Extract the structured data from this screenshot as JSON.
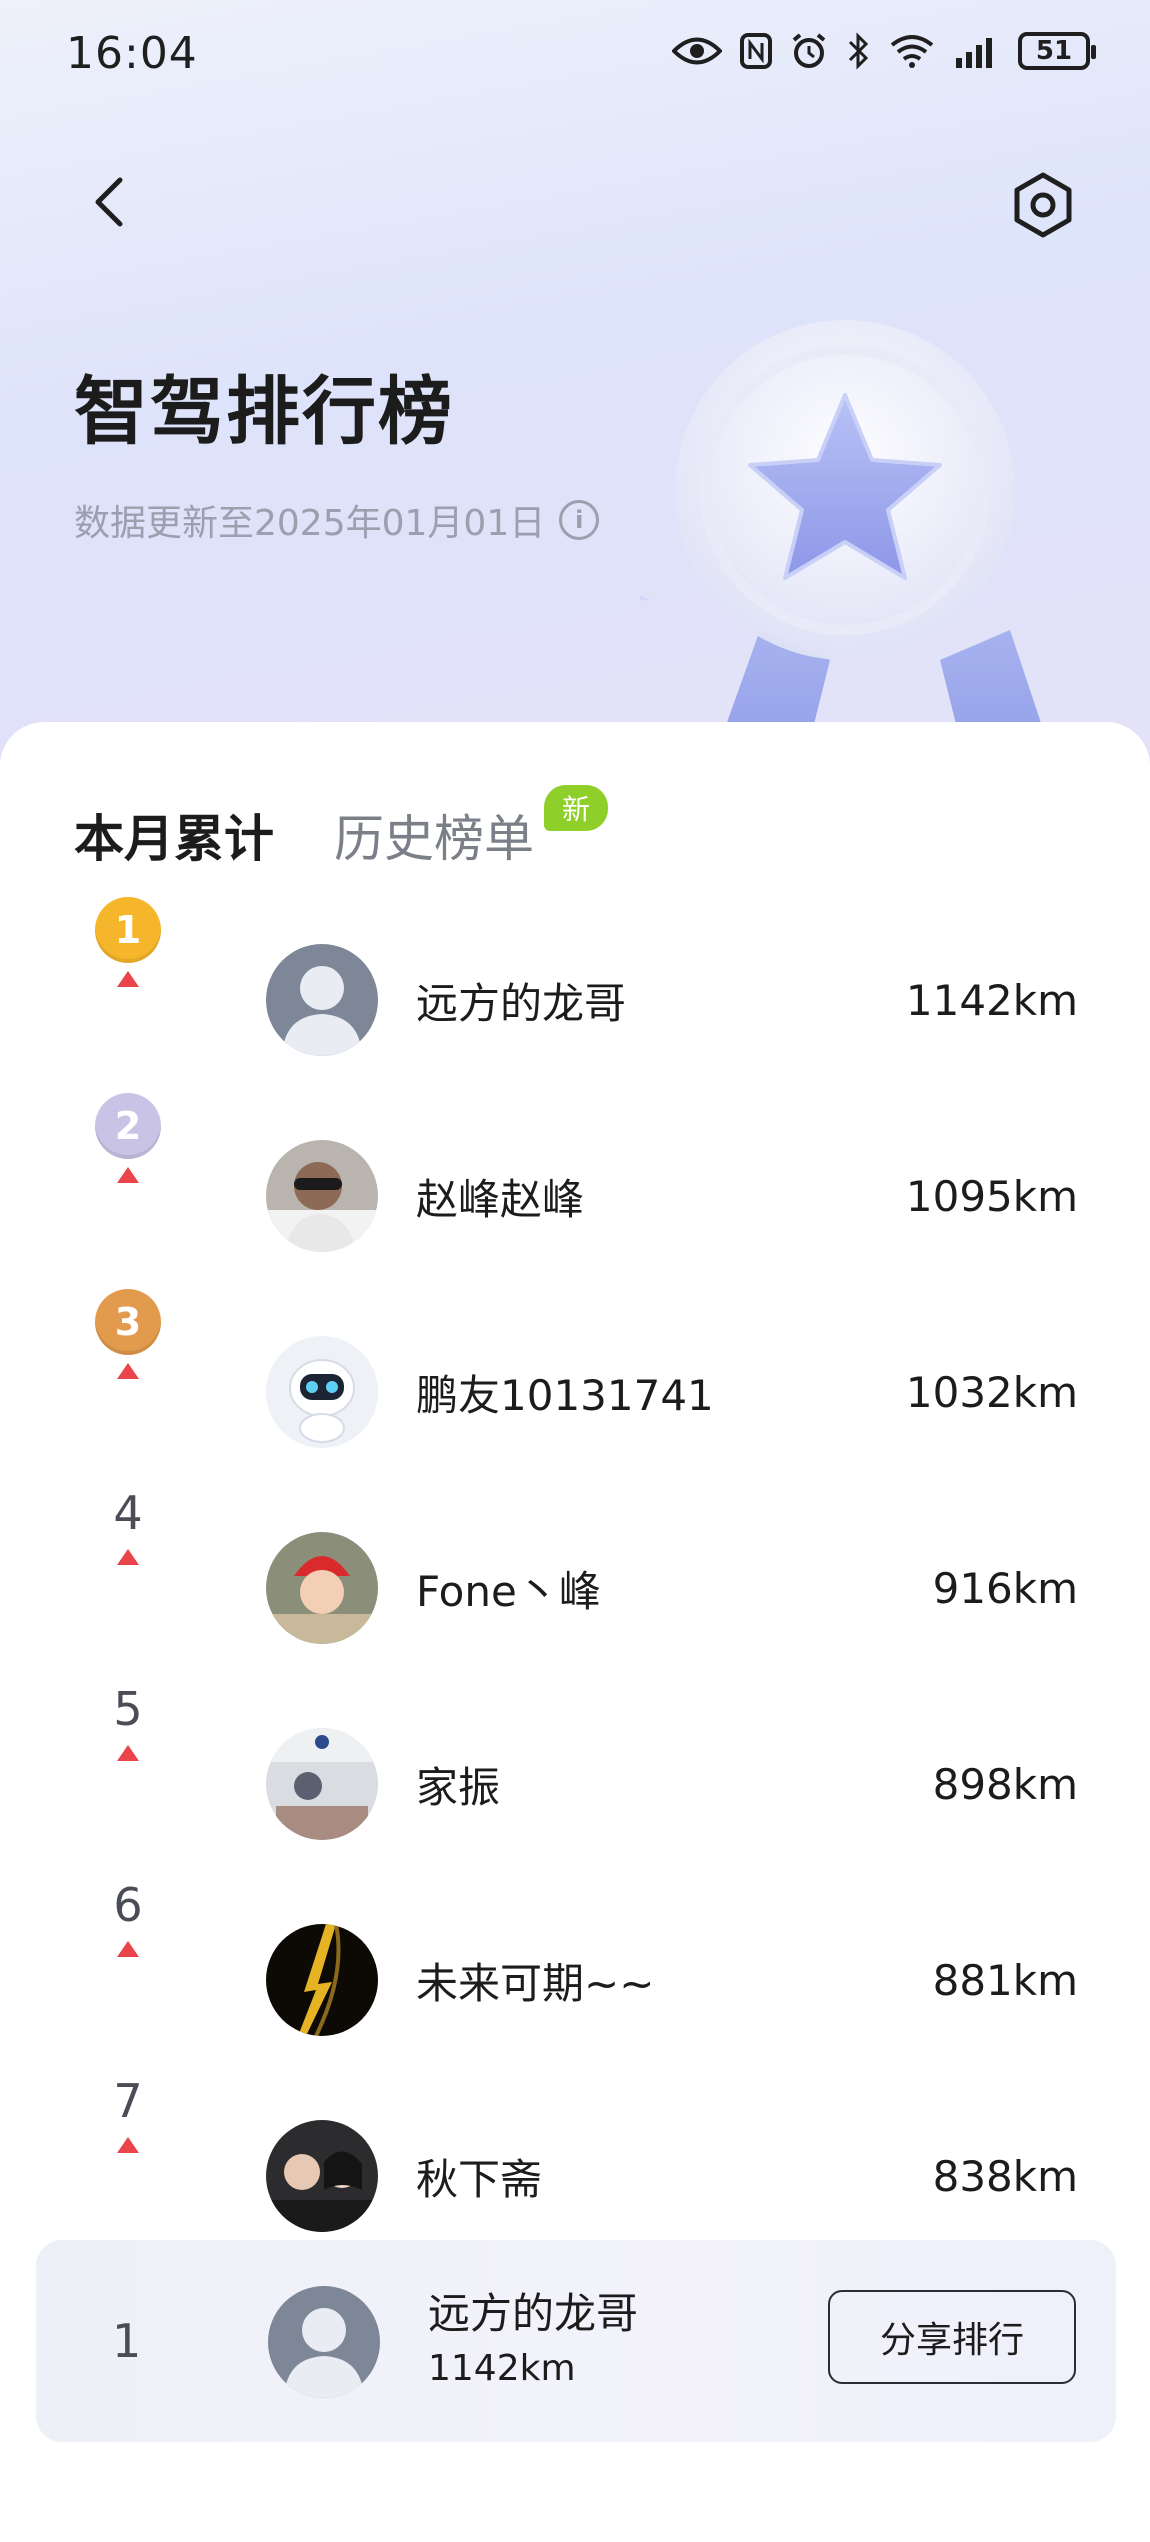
{
  "status_bar": {
    "time": "16:04",
    "battery": "51"
  },
  "header": {
    "title": "智驾排行榜",
    "subtitle": "数据更新至2025年01月01日"
  },
  "tabs": [
    {
      "label": "本月累计",
      "active": true
    },
    {
      "label": "历史榜单",
      "active": false,
      "badge": "新"
    }
  ],
  "ranking": [
    {
      "rank": "1",
      "name": "远方的龙哥",
      "distance": "1142km",
      "trend": "up",
      "medal": "gold"
    },
    {
      "rank": "2",
      "name": "赵峰赵峰",
      "distance": "1095km",
      "trend": "up",
      "medal": "silver"
    },
    {
      "rank": "3",
      "name": "鹏友10131741",
      "distance": "1032km",
      "trend": "up",
      "medal": "bronze"
    },
    {
      "rank": "4",
      "name": "Fone丶峰",
      "distance": "916km",
      "trend": "up"
    },
    {
      "rank": "5",
      "name": "家振",
      "distance": "898km",
      "trend": "up"
    },
    {
      "rank": "6",
      "name": "未来可期~~",
      "distance": "881km",
      "trend": "up"
    },
    {
      "rank": "7",
      "name": "秋下斋",
      "distance": "838km",
      "trend": "up"
    }
  ],
  "my_rank": {
    "rank": "1",
    "name": "远方的龙哥",
    "distance": "1142km",
    "share_label": "分享排行"
  },
  "colors": {
    "gold": "#f5b62b",
    "silver": "#c9c3e6",
    "bronze": "#e29a4c",
    "trend_up": "#e8444a",
    "new_badge": "#8fcf2a"
  }
}
